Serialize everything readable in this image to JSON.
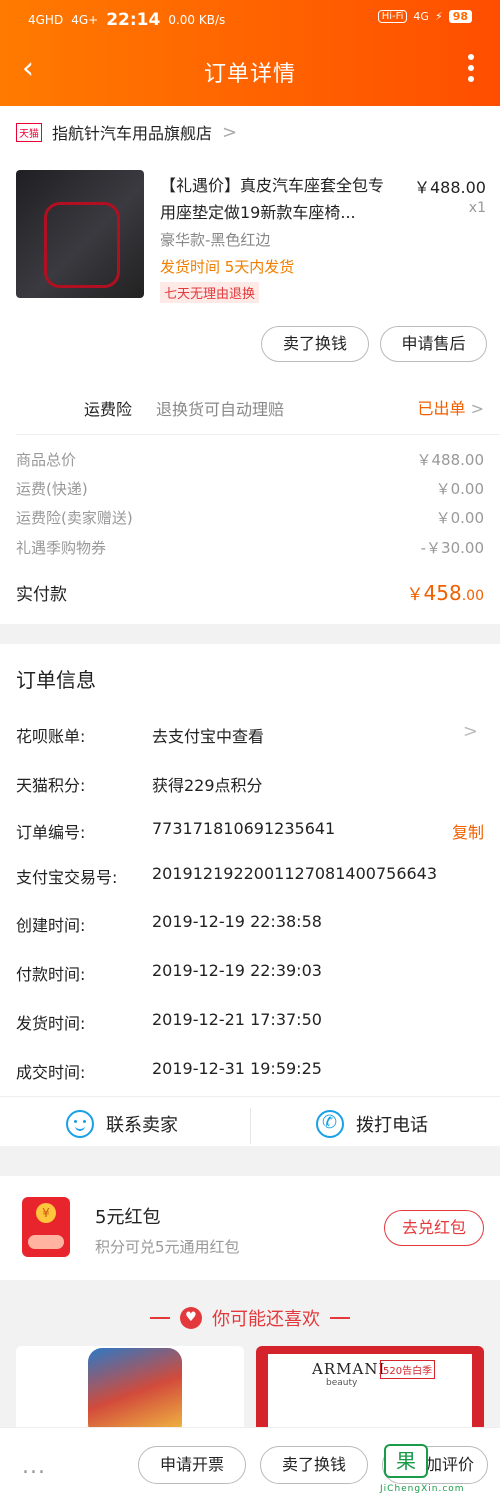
{
  "status_bar": {
    "net1": "4GHD",
    "net2": "4G+",
    "time": "22:14",
    "speed": "0.00 KB/s",
    "hifi": "Hi-Fi",
    "net3": "4G",
    "battery": "98"
  },
  "nav": {
    "title": "订单详情",
    "back_icon": "chevron-left-icon",
    "more_icon": "more-vertical-icon"
  },
  "store": {
    "badge": "天猫",
    "name": "指航针汽车用品旗舰店",
    "chevron": ">"
  },
  "product": {
    "title": "【礼遇价】真皮汽车座套全包专用座垫定做19新款车座椅...",
    "price": "￥488.00",
    "qty": "x1",
    "sku": "豪华款-黑色红边",
    "ship": "发货时间  5天内发货",
    "tag": "七天无理由退换",
    "actions": [
      "卖了换钱",
      "申请售后"
    ]
  },
  "insurance": {
    "label": "运费险",
    "desc": "退换货可自动理赔",
    "status": "已出单",
    "chevron": ">"
  },
  "fees": [
    {
      "label": "商品总价",
      "value": "￥488.00"
    },
    {
      "label": "运费(快递)",
      "value": "￥0.00"
    },
    {
      "label": "运费险(卖家赠送)",
      "value": "￥0.00"
    },
    {
      "label": "礼遇季购物券",
      "value": "-￥30.00"
    }
  ],
  "total": {
    "label": "实付款",
    "currency": "￥",
    "integer": "458",
    "decimal": ".00"
  },
  "order_info": {
    "title": "订单信息",
    "rows": [
      {
        "key": "花呗账单:",
        "value": "去支付宝中查看",
        "action": ""
      },
      {
        "key": "天猫积分:",
        "value": "获得229点积分",
        "action": ""
      },
      {
        "key": "订单编号:",
        "value": "773171810691235641",
        "action": "复制"
      },
      {
        "key": "支付宝交易号:",
        "value": "2019121922001127081400756643",
        "action": ""
      },
      {
        "key": "创建时间:",
        "value": "2019-12-19 22:38:58",
        "action": ""
      },
      {
        "key": "付款时间:",
        "value": "2019-12-19 22:39:03",
        "action": ""
      },
      {
        "key": "发货时间:",
        "value": "2019-12-21 17:37:50",
        "action": ""
      },
      {
        "key": "成交时间:",
        "value": "2019-12-31 19:59:25",
        "action": ""
      }
    ],
    "chevron": ">"
  },
  "contact": {
    "seller": "联系卖家",
    "phone": "拨打电话"
  },
  "hongbao": {
    "title": "5元红包",
    "subtitle": "积分可兑5元通用红包",
    "button": "去兑红包"
  },
  "recommend": {
    "title": "你可能还喜欢",
    "armani": "ARMANI",
    "armani_sub": "beauty",
    "promo": "520告白季"
  },
  "bottom_bar": {
    "more": "...",
    "buttons": [
      "申请开票",
      "卖了换钱",
      "加评价"
    ]
  },
  "watermark": {
    "char": "果",
    "text": "JiChengXin.com"
  },
  "colors": {
    "header_start": "#ff7a00",
    "header_end": "#ff4e00",
    "accent": "#f06000",
    "red": "#e4393c",
    "blue": "#19a0e6"
  }
}
